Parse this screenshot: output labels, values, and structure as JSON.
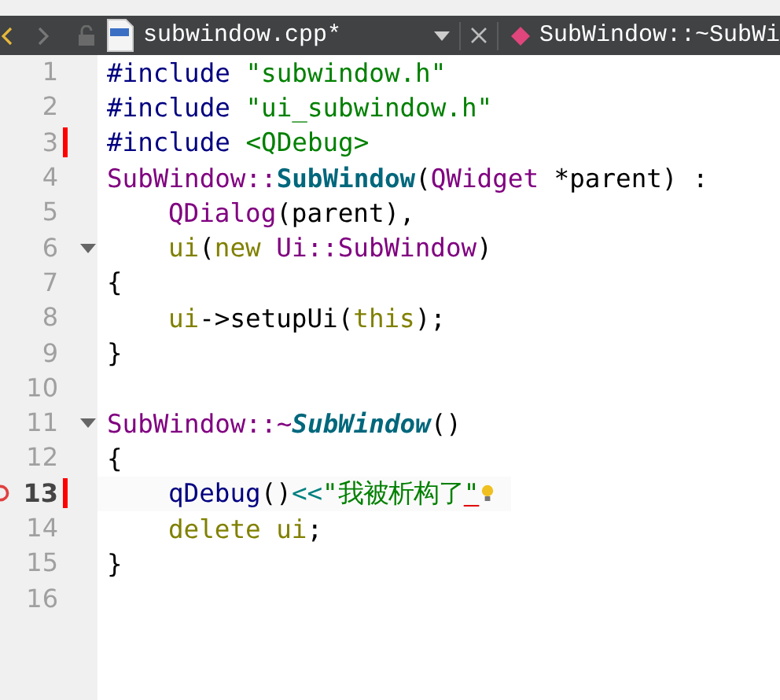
{
  "toolbar": {
    "filename": "subwindow.cpp*",
    "symbol": "SubWindow::~SubWi",
    "back_enabled": true,
    "forward_enabled": false
  },
  "editor": {
    "lines": [
      {
        "number": "1",
        "indented": false,
        "changed": false,
        "foldable": false,
        "breakpoint": false,
        "current": false,
        "tokens": [
          {
            "text": "#include ",
            "kind": "pre"
          },
          {
            "text": "\"subwindow.h\"",
            "kind": "string"
          }
        ]
      },
      {
        "number": "2",
        "indented": false,
        "changed": false,
        "foldable": false,
        "breakpoint": false,
        "current": false,
        "tokens": [
          {
            "text": "#include ",
            "kind": "pre"
          },
          {
            "text": "\"ui_subwindow.h\"",
            "kind": "string"
          }
        ]
      },
      {
        "number": "3",
        "indented": false,
        "changed": true,
        "foldable": false,
        "breakpoint": false,
        "current": false,
        "tokens": [
          {
            "text": "#include ",
            "kind": "pre"
          },
          {
            "text": "<QDebug>",
            "kind": "string"
          }
        ]
      },
      {
        "number": "4",
        "indented": false,
        "changed": false,
        "foldable": false,
        "breakpoint": false,
        "current": false,
        "tokens": [
          {
            "text": "SubWindow::",
            "kind": "type"
          },
          {
            "text": "SubWindow",
            "kind": "decl"
          },
          {
            "text": "(",
            "kind": "plain"
          },
          {
            "text": "QWidget",
            "kind": "type"
          },
          {
            "text": " *parent) :",
            "kind": "plain"
          }
        ]
      },
      {
        "number": "5",
        "indented": true,
        "changed": false,
        "foldable": false,
        "breakpoint": false,
        "current": false,
        "tokens": [
          {
            "text": "QDialog",
            "kind": "type"
          },
          {
            "text": "(parent),",
            "kind": "plain"
          }
        ]
      },
      {
        "number": "6",
        "indented": true,
        "changed": false,
        "foldable": true,
        "breakpoint": false,
        "current": false,
        "tokens": [
          {
            "text": "ui",
            "kind": "member"
          },
          {
            "text": "(",
            "kind": "plain"
          },
          {
            "text": "new ",
            "kind": "keyword"
          },
          {
            "text": "Ui::SubWindow",
            "kind": "type"
          },
          {
            "text": ")",
            "kind": "plain"
          }
        ]
      },
      {
        "number": "7",
        "indented": false,
        "changed": false,
        "foldable": false,
        "breakpoint": false,
        "current": false,
        "tokens": [
          {
            "text": "{",
            "kind": "plain"
          }
        ]
      },
      {
        "number": "8",
        "indented": true,
        "changed": false,
        "foldable": false,
        "breakpoint": false,
        "current": false,
        "tokens": [
          {
            "text": "ui",
            "kind": "member"
          },
          {
            "text": "->setupUi(",
            "kind": "plain"
          },
          {
            "text": "this",
            "kind": "keyword"
          },
          {
            "text": ");",
            "kind": "plain"
          }
        ]
      },
      {
        "number": "9",
        "indented": false,
        "changed": false,
        "foldable": false,
        "breakpoint": false,
        "current": false,
        "tokens": [
          {
            "text": "}",
            "kind": "plain"
          }
        ]
      },
      {
        "number": "10",
        "indented": false,
        "changed": false,
        "foldable": false,
        "breakpoint": false,
        "current": false
      },
      {
        "number": "11",
        "indented": false,
        "changed": false,
        "foldable": true,
        "breakpoint": false,
        "current": false,
        "tokens": [
          {
            "text": "SubWindow::~",
            "kind": "type"
          },
          {
            "text": "SubWindow",
            "kind": "decl-italic"
          },
          {
            "text": "()",
            "kind": "plain"
          }
        ]
      },
      {
        "number": "12",
        "indented": false,
        "changed": false,
        "foldable": false,
        "breakpoint": false,
        "current": false,
        "tokens": [
          {
            "text": "{",
            "kind": "plain"
          }
        ]
      },
      {
        "number": "13",
        "indented": true,
        "changed": true,
        "foldable": false,
        "breakpoint": true,
        "current": true,
        "hint": true,
        "tokens": [
          {
            "text": "qDebug",
            "kind": "func"
          },
          {
            "text": "()",
            "kind": "plain"
          },
          {
            "text": "<<",
            "kind": "operator"
          },
          {
            "text": "\"我被析构了",
            "kind": "string"
          },
          {
            "text": "\"",
            "kind": "string-warning"
          }
        ]
      },
      {
        "number": "14",
        "indented": true,
        "changed": false,
        "foldable": false,
        "breakpoint": false,
        "current": false,
        "tokens": [
          {
            "text": "delete ",
            "kind": "keyword"
          },
          {
            "text": "ui",
            "kind": "member"
          },
          {
            "text": ";",
            "kind": "plain"
          }
        ]
      },
      {
        "number": "15",
        "indented": false,
        "changed": false,
        "foldable": false,
        "breakpoint": false,
        "current": false,
        "tokens": [
          {
            "text": "}",
            "kind": "plain"
          }
        ]
      },
      {
        "number": "16",
        "indented": false,
        "changed": false,
        "foldable": false,
        "breakpoint": false,
        "current": false
      }
    ]
  }
}
